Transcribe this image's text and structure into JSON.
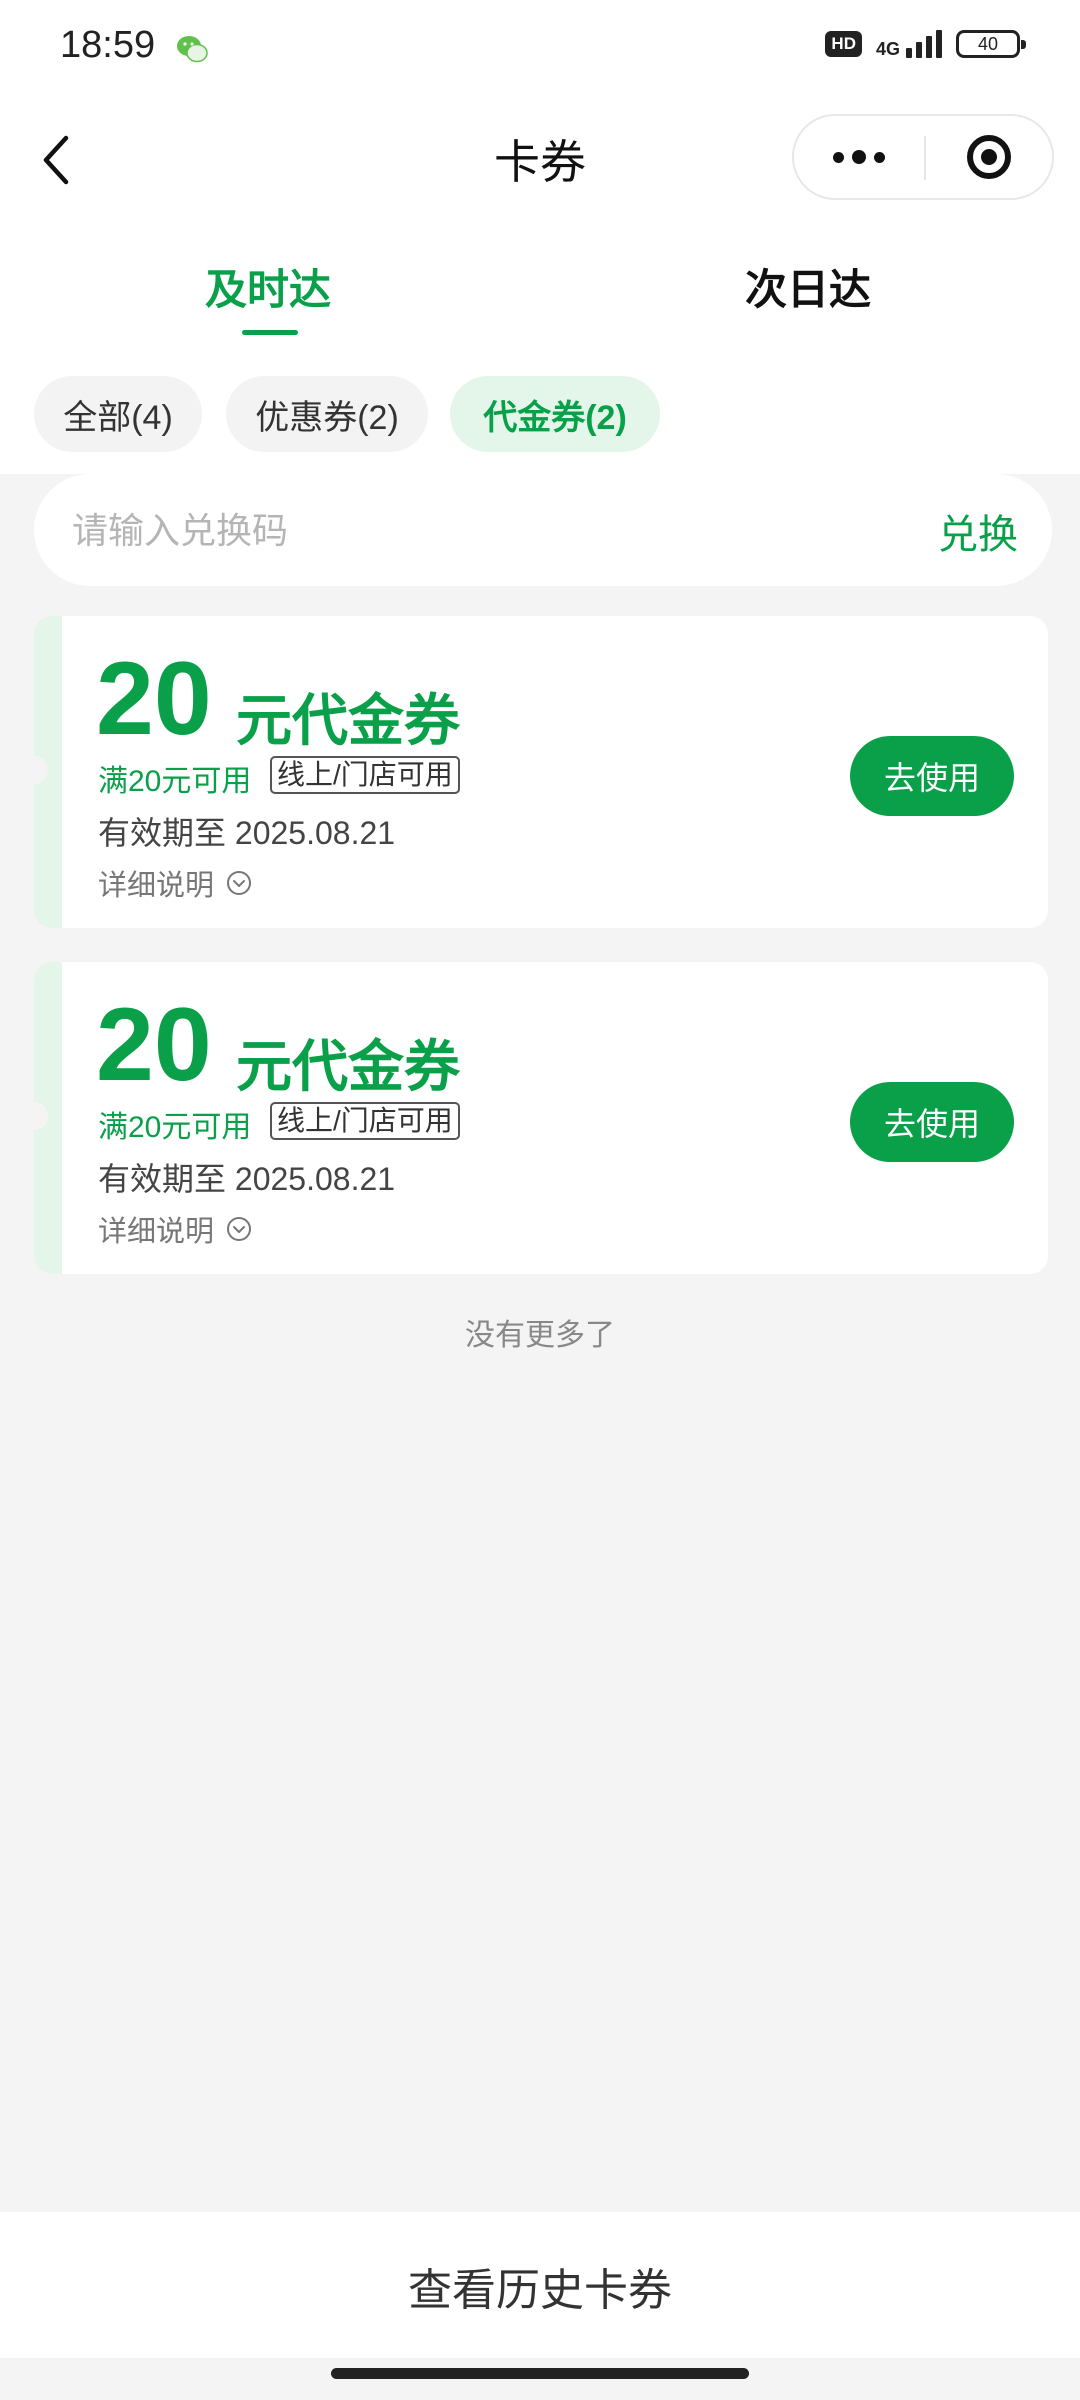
{
  "status_bar": {
    "time": "18:59",
    "hd": "HD",
    "network": "4G",
    "battery": "40"
  },
  "nav": {
    "title": "卡券",
    "icons": [
      "back-icon",
      "more-icon",
      "target-icon"
    ]
  },
  "tabs": [
    {
      "label": "及时达",
      "active": true
    },
    {
      "label": "次日达",
      "active": false
    }
  ],
  "filters": [
    {
      "label": "全部(4)",
      "active": false
    },
    {
      "label": "优惠券(2)",
      "active": false
    },
    {
      "label": "代金券(2)",
      "active": true
    }
  ],
  "redeem": {
    "placeholder": "请输入兑换码",
    "button_label": "兑换"
  },
  "coupons": [
    {
      "amount": "20",
      "type": "元代金券",
      "condition": "满20元可用",
      "tag": "线上/门店可用",
      "validity": "有效期至 2025.08.21",
      "details_label": "详细说明",
      "button_label": "去使用"
    },
    {
      "amount": "20",
      "type": "元代金券",
      "condition": "满20元可用",
      "tag": "线上/门店可用",
      "validity": "有效期至 2025.08.21",
      "details_label": "详细说明",
      "button_label": "去使用"
    }
  ],
  "footer_note": "没有更多了",
  "bottom_button": "查看历史卡券",
  "colors": {
    "accent": "#0aa04a",
    "accent_light": "#e3f6e9",
    "background": "#f4f4f4"
  }
}
